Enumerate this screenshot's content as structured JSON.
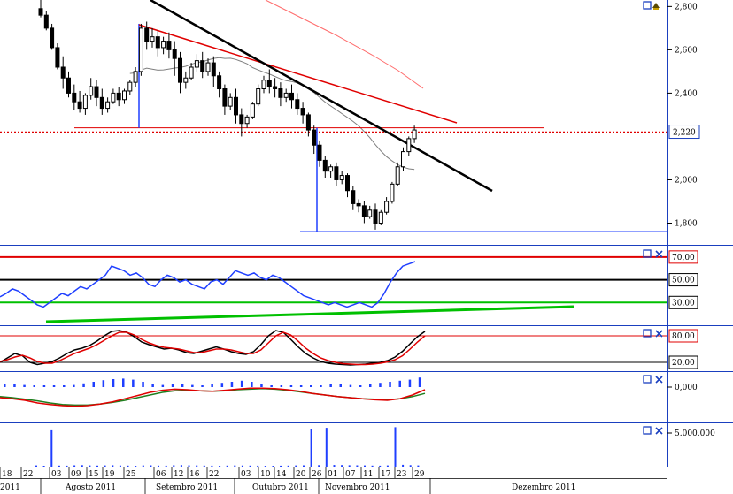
{
  "colors": {
    "price_axis_box": "#1a3fbf",
    "last_price_box": "#1a3fbf",
    "rsi_line": "#1f3fff",
    "stoch_k": "#000000",
    "stoch_d": "#e00000",
    "level_red": "#e00000",
    "level_black": "#000000",
    "level_green": "#00c000",
    "trend_red": "#e00000",
    "trend_black": "#000000",
    "support_blue": "#1f3fff",
    "ma_long": "#ff6b6b",
    "ma_short": "#7f7f7f",
    "hist_blue": "#1f3fff",
    "macd_red": "#e00000",
    "macd_green": "#1f7f1f",
    "volume_blue": "#1f3fff",
    "panel_border": "#1a3fbf"
  },
  "price_axis": {
    "labels": [
      "2,800",
      "2,600",
      "2,400",
      "2,220",
      "2,000",
      "1,800"
    ],
    "values": [
      2800,
      2600,
      2400,
      2220,
      2000,
      1800
    ],
    "highlight_label": "2,220",
    "highlight_value": 2220
  },
  "rsi_axis": {
    "labels": [
      "70,00",
      "50,00",
      "30,00"
    ],
    "values": [
      70,
      50,
      30
    ]
  },
  "stoch_axis": {
    "labels": [
      "80,00",
      "20,00"
    ],
    "values": [
      80,
      20
    ]
  },
  "macd_axis": {
    "labels": [
      "0,000"
    ],
    "values": [
      0
    ]
  },
  "volume_axis": {
    "labels": [
      "5.000.000"
    ],
    "values": [
      5000000
    ]
  },
  "date_axis": {
    "days": [
      "18",
      "22",
      "03",
      "09",
      "15",
      "19",
      "25",
      "06",
      "12",
      "16",
      "22",
      "03",
      "10",
      "14",
      "20",
      "26",
      "01",
      "07",
      "11",
      "17",
      "23",
      "29"
    ],
    "months": [
      "2011",
      "Agosto 2011",
      "Setembro 2011",
      "Outubro 2011",
      "Novembro 2011",
      "Dezembro 2011"
    ]
  },
  "icons": {
    "panel_toggle": "square-icon",
    "panel_close": "x-icon",
    "alert": "bell-icon"
  },
  "chart_data": [
    {
      "type": "candlestick",
      "panel": "price",
      "ylim": [
        1700,
        2830
      ],
      "grid": false,
      "candles": [
        [
          2790,
          2840,
          2760,
          2750
        ],
        [
          2760,
          2780,
          2700,
          2690
        ],
        [
          2700,
          2720,
          2610,
          2600
        ],
        [
          2610,
          2630,
          2520,
          2510
        ],
        [
          2520,
          2570,
          2470,
          2420
        ],
        [
          2470,
          2500,
          2400,
          2380
        ],
        [
          2400,
          2440,
          2360,
          2320
        ],
        [
          2360,
          2410,
          2330,
          2310
        ],
        [
          2330,
          2400,
          2390,
          2300
        ],
        [
          2390,
          2470,
          2430,
          2370
        ],
        [
          2430,
          2460,
          2380,
          2340
        ],
        [
          2380,
          2420,
          2330,
          2300
        ],
        [
          2330,
          2380,
          2360,
          2310
        ],
        [
          2360,
          2420,
          2400,
          2350
        ],
        [
          2400,
          2430,
          2370,
          2340
        ],
        [
          2370,
          2420,
          2410,
          2350
        ],
        [
          2410,
          2460,
          2450,
          2390
        ],
        [
          2450,
          2520,
          2500,
          2430
        ],
        [
          2500,
          2720,
          2700,
          2480
        ],
        [
          2700,
          2730,
          2640,
          2600
        ],
        [
          2640,
          2700,
          2660,
          2610
        ],
        [
          2660,
          2690,
          2610,
          2570
        ],
        [
          2610,
          2660,
          2640,
          2580
        ],
        [
          2640,
          2680,
          2600,
          2560
        ],
        [
          2600,
          2640,
          2560,
          2480
        ],
        [
          2560,
          2590,
          2450,
          2400
        ],
        [
          2450,
          2500,
          2470,
          2420
        ],
        [
          2470,
          2540,
          2520,
          2460
        ],
        [
          2520,
          2580,
          2550,
          2500
        ],
        [
          2550,
          2590,
          2500,
          2470
        ],
        [
          2500,
          2560,
          2540,
          2480
        ],
        [
          2540,
          2570,
          2480,
          2430
        ],
        [
          2480,
          2500,
          2420,
          2380
        ],
        [
          2420,
          2440,
          2340,
          2300
        ],
        [
          2340,
          2400,
          2380,
          2320
        ],
        [
          2380,
          2420,
          2300,
          2260
        ],
        [
          2300,
          2330,
          2260,
          2200
        ],
        [
          2260,
          2300,
          2290,
          2240
        ],
        [
          2290,
          2360,
          2350,
          2280
        ],
        [
          2350,
          2440,
          2420,
          2340
        ],
        [
          2420,
          2480,
          2460,
          2400
        ],
        [
          2460,
          2510,
          2430,
          2400
        ],
        [
          2430,
          2470,
          2420,
          2380
        ],
        [
          2420,
          2450,
          2380,
          2340
        ],
        [
          2380,
          2420,
          2400,
          2360
        ],
        [
          2400,
          2440,
          2370,
          2330
        ],
        [
          2370,
          2400,
          2330,
          2300
        ],
        [
          2330,
          2360,
          2300,
          2260
        ],
        [
          2300,
          2310,
          2230,
          2200
        ],
        [
          2230,
          2250,
          2160,
          2120
        ],
        [
          2160,
          2180,
          2090,
          2060
        ],
        [
          2090,
          2110,
          2040,
          2010
        ],
        [
          2040,
          2070,
          2060,
          2010
        ],
        [
          2060,
          2080,
          2000,
          1970
        ],
        [
          2000,
          2040,
          2020,
          1980
        ],
        [
          2020,
          2030,
          1950,
          1920
        ],
        [
          1950,
          1970,
          1890,
          1860
        ],
        [
          1890,
          1910,
          1880,
          1850
        ],
        [
          1880,
          1900,
          1830,
          1800
        ],
        [
          1830,
          1880,
          1860,
          1820
        ],
        [
          1860,
          1890,
          1800,
          1770
        ],
        [
          1800,
          1860,
          1850,
          1790
        ],
        [
          1850,
          1920,
          1900,
          1840
        ],
        [
          1900,
          1990,
          1980,
          1890
        ],
        [
          1980,
          2080,
          2060,
          1970
        ],
        [
          2060,
          2150,
          2130,
          2040
        ],
        [
          2130,
          2200,
          2190,
          2110
        ],
        [
          2190,
          2250,
          2230,
          2170
        ]
      ]
    },
    {
      "type": "line",
      "panel": "rsi",
      "ylim": [
        10,
        80
      ],
      "series": [
        {
          "values": [
            35,
            38,
            42,
            40,
            36,
            32,
            28,
            26,
            30,
            34,
            38,
            36,
            40,
            44,
            42,
            46,
            50,
            54,
            62,
            60,
            58,
            54,
            56,
            52,
            46,
            44,
            50,
            54,
            52,
            48,
            50,
            46,
            44,
            42,
            48,
            50,
            46,
            52,
            58,
            56,
            54,
            56,
            52,
            50,
            54,
            52,
            48,
            44,
            40,
            36,
            34,
            32,
            30,
            28,
            30,
            28,
            26,
            28,
            30,
            28,
            26,
            30,
            38,
            48,
            56,
            62,
            64,
            66
          ]
        }
      ]
    },
    {
      "type": "line",
      "panel": "stochastic",
      "ylim": [
        0,
        100
      ],
      "series": [
        {
          "values": [
            20,
            30,
            40,
            35,
            20,
            15,
            18,
            22,
            30,
            40,
            48,
            52,
            58,
            68,
            80,
            90,
            92,
            88,
            78,
            66,
            60,
            55,
            50,
            52,
            48,
            42,
            40,
            45,
            50,
            55,
            50,
            44,
            40,
            38,
            44,
            60,
            80,
            92,
            88,
            72,
            55,
            40,
            30,
            22,
            18,
            16,
            15,
            14,
            15,
            16,
            18,
            20,
            24,
            32,
            45,
            62,
            78,
            90
          ]
        },
        {
          "values": [
            22,
            26,
            32,
            36,
            30,
            22,
            18,
            18,
            24,
            32,
            40,
            46,
            52,
            60,
            70,
            80,
            88,
            88,
            82,
            72,
            64,
            58,
            54,
            52,
            50,
            46,
            42,
            42,
            46,
            50,
            50,
            48,
            44,
            40,
            40,
            48,
            64,
            80,
            88,
            82,
            68,
            52,
            40,
            30,
            24,
            20,
            17,
            16,
            15,
            15,
            16,
            18,
            21,
            26,
            35,
            50,
            66,
            80
          ]
        }
      ]
    },
    {
      "type": "bar+line",
      "panel": "macd",
      "series": [
        {
          "values": [
            0.05,
            0.05,
            0.04,
            0.03,
            0.02,
            0.01,
            0.02,
            0.04,
            0.07,
            0.1,
            0.13,
            0.15,
            0.16,
            0.14,
            0.1,
            0.06,
            0.04,
            0.05,
            0.06,
            0.04,
            0.03,
            0.05,
            0.08,
            0.1,
            0.12,
            0.1,
            0.06,
            0.03,
            0.02,
            0.03,
            0.02,
            0.01,
            0.03,
            0.05,
            0.06,
            0.04,
            0.03,
            0.05,
            0.08,
            0.1,
            0.12,
            0.14,
            0.18
          ]
        },
        {
          "values": [
            -0.2,
            -0.22,
            -0.25,
            -0.3,
            -0.33,
            -0.35,
            -0.36,
            -0.35,
            -0.32,
            -0.28,
            -0.22,
            -0.16,
            -0.1,
            -0.06,
            -0.04,
            -0.05,
            -0.07,
            -0.08,
            -0.06,
            -0.04,
            -0.02,
            -0.02,
            -0.03,
            -0.05,
            -0.08,
            -0.12,
            -0.15,
            -0.18,
            -0.2,
            -0.22,
            -0.24,
            -0.25,
            -0.22,
            -0.15,
            -0.05
          ]
        },
        {
          "values": [
            -0.18,
            -0.2,
            -0.23,
            -0.26,
            -0.3,
            -0.33,
            -0.34,
            -0.34,
            -0.32,
            -0.29,
            -0.25,
            -0.2,
            -0.15,
            -0.1,
            -0.07,
            -0.06,
            -0.07,
            -0.08,
            -0.07,
            -0.05,
            -0.04,
            -0.03,
            -0.04,
            -0.06,
            -0.09,
            -0.12,
            -0.15,
            -0.18,
            -0.2,
            -0.22,
            -0.23,
            -0.24,
            -0.22,
            -0.18,
            -0.12
          ]
        }
      ]
    },
    {
      "type": "bar",
      "panel": "volume",
      "ylim": [
        0,
        7000000
      ],
      "values": [
        200000,
        150000,
        6000000,
        180000,
        160000,
        220000,
        250000,
        200000,
        180000,
        210000,
        230000,
        190000,
        170000,
        150000,
        200000,
        220000,
        180000,
        160000,
        240000,
        260000,
        220000,
        200000,
        180000,
        160000,
        150000,
        170000,
        200000,
        190000,
        180000,
        160000,
        150000,
        140000,
        160000,
        180000,
        200000,
        220000,
        6200000,
        250000,
        6400000,
        280000,
        260000,
        240000,
        220000,
        200000,
        180000,
        160000,
        200000,
        6500000,
        300000,
        250000,
        200000
      ]
    }
  ]
}
